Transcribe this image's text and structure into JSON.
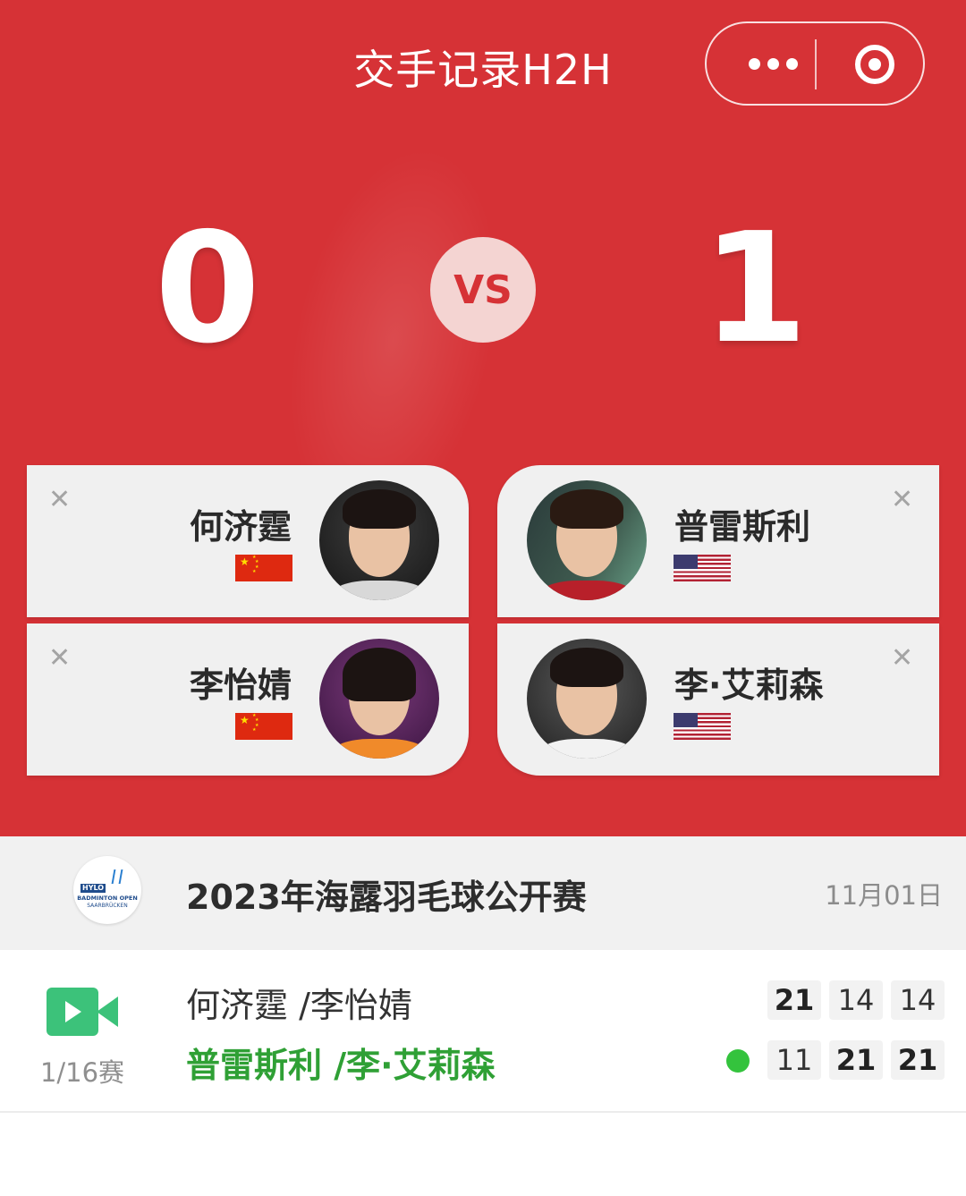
{
  "header": {
    "title": "交手记录H2H",
    "more_icon": "more-dots-icon",
    "close_icon": "target-close-icon"
  },
  "scoreboard": {
    "left_score": "0",
    "vs_label": "VS",
    "right_score": "1"
  },
  "players": {
    "left": [
      {
        "name": "何济霆",
        "country": "China",
        "flag": "cn-flag-icon"
      },
      {
        "name": "李怡婧",
        "country": "China",
        "flag": "cn-flag-icon"
      }
    ],
    "right": [
      {
        "name": "普雷斯利",
        "country": "USA",
        "flag": "us-flag-icon"
      },
      {
        "name": "李·艾莉森",
        "country": "USA",
        "flag": "us-flag-icon"
      }
    ],
    "remove_glyph": "✕"
  },
  "event": {
    "logo_text": "HYLO",
    "logo_line1": "BADMINTON OPEN",
    "logo_line2": "SAARBRÜCKEN",
    "name": "2023年海露羽毛球公开赛",
    "date": "11月01日"
  },
  "match": {
    "round": "1/16赛",
    "team1": "何济霆 /李怡婧",
    "team2": "普雷斯利 /李·艾莉森",
    "team1_scores": [
      "21",
      "14",
      "14"
    ],
    "team2_scores": [
      "11",
      "21",
      "21"
    ],
    "winner": "team2",
    "video_icon": "video-camera-icon"
  },
  "colors": {
    "primary_red": "#d63236",
    "winner_green": "#2fa035",
    "video_green": "#3cc27a"
  }
}
